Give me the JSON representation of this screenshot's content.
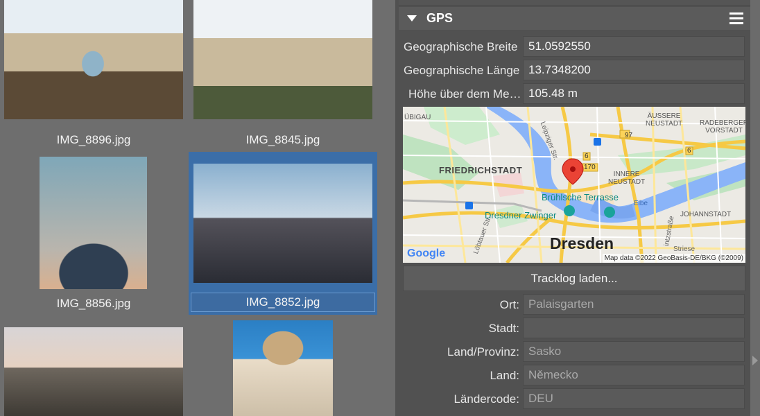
{
  "thumbnails": [
    {
      "file": "IMG_8896.jpg"
    },
    {
      "file": "IMG_8845.jpg"
    },
    {
      "file": "IMG_8856.jpg"
    },
    {
      "file": "IMG_8852.jpg",
      "selected": true
    },
    {
      "file": ""
    },
    {
      "file": ""
    }
  ],
  "gps": {
    "title": "GPS",
    "latitude_label": "Geographische Breite",
    "latitude": "51.0592550",
    "longitude_label": "Geographische Länge",
    "longitude": "13.7348200",
    "altitude_label": "Höhe über dem Meeresspiegel",
    "altitude": "105.48 m",
    "tracklog_button": "Tracklog laden..."
  },
  "map": {
    "labels": {
      "ubigau": "ÜBIGAU",
      "leipziger": "Leipziger Str.",
      "aussere_neustadt": "ÄUSSERE\nNEUSTADT",
      "radeberger": "RADEBERGER\nVORSTADT",
      "friedrichstadt": "FRIEDRICHSTADT",
      "innere_neustadt": "INNERE\nNEUSTADT",
      "bruehlsche": "Brühlsche Terrasse",
      "zwinger": "Dresdner Zwinger",
      "elbe": "Elbe",
      "johannstadt": "JOHANNSTADT",
      "lobtauer": "Löbtauer Str.",
      "dresden": "Dresden",
      "google": "Google",
      "attribution": "Map data ©2022 GeoBasis-DE/BKG (©2009)",
      "road_97": "97",
      "road_6a": "6",
      "road_6b": "6",
      "road_170": "170",
      "intzstrasse": "intzstraße",
      "striese": "Striese"
    },
    "colors": {
      "water": "#8ab4f8",
      "park": "#bfe3c0",
      "road": "#fbd35a",
      "pin": "#ea4335"
    }
  },
  "location": {
    "ort_label": "Ort:",
    "ort": "Palaisgarten",
    "stadt_label": "Stadt:",
    "stadt": "",
    "provinz_label": "Land/Provinz:",
    "provinz": "Sasko",
    "land_label": "Land:",
    "land": "Německo",
    "code_label": "Ländercode:",
    "code": "DEU"
  }
}
